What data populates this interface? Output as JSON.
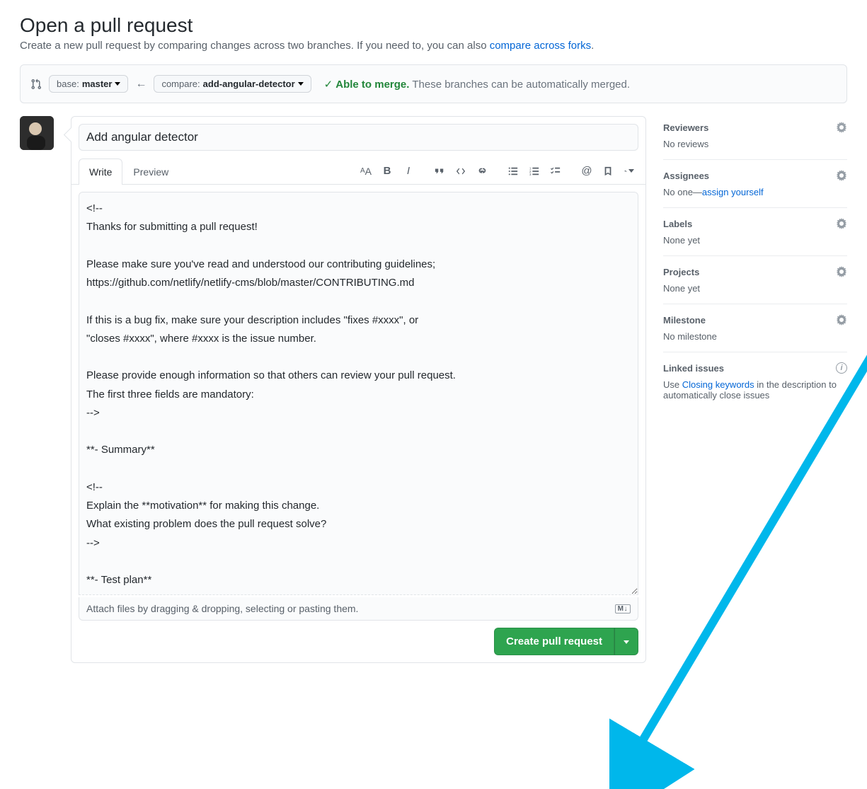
{
  "header": {
    "title": "Open a pull request",
    "subtitle_prefix": "Create a new pull request by comparing changes across two branches. If you need to, you can also ",
    "subtitle_link": "compare across forks",
    "subtitle_suffix": "."
  },
  "compare": {
    "base_label": "base:",
    "base_value": "master",
    "compare_label": "compare:",
    "compare_value": "add-angular-detector",
    "merge_ok_text": "Able to merge.",
    "merge_detail": "These branches can be automatically merged."
  },
  "editor": {
    "title_value": "Add angular detector",
    "tab_write": "Write",
    "tab_preview": "Preview",
    "body_value": "<!--\nThanks for submitting a pull request!\n\nPlease make sure you've read and understood our contributing guidelines;\nhttps://github.com/netlify/netlify-cms/blob/master/CONTRIBUTING.md\n\nIf this is a bug fix, make sure your description includes \"fixes #xxxx\", or\n\"closes #xxxx\", where #xxxx is the issue number.\n\nPlease provide enough information so that others can review your pull request.\nThe first three fields are mandatory:\n-->\n\n**- Summary**\n\n<!--\nExplain the **motivation** for making this change.\nWhat existing problem does the pull request solve?\n-->\n\n**- Test plan**",
    "attach_text": "Attach files by dragging & dropping, selecting or pasting them.",
    "md_badge": "M↓",
    "submit_label": "Create pull request"
  },
  "toolbar_icons": {
    "heading": "heading-icon",
    "bold": "bold-icon",
    "italic": "italic-icon",
    "quote": "quote-icon",
    "code": "code-icon",
    "link": "link-icon",
    "ul": "unordered-list-icon",
    "ol": "ordered-list-icon",
    "task": "task-list-icon",
    "mention": "mention-icon",
    "reference": "reference-icon",
    "reply": "reply-icon"
  },
  "sidebar": {
    "reviewers": {
      "title": "Reviewers",
      "body": "No reviews"
    },
    "assignees": {
      "title": "Assignees",
      "body_prefix": "No one—",
      "body_link": "assign yourself"
    },
    "labels": {
      "title": "Labels",
      "body": "None yet"
    },
    "projects": {
      "title": "Projects",
      "body": "None yet"
    },
    "milestone": {
      "title": "Milestone",
      "body": "No milestone"
    },
    "linked": {
      "title": "Linked issues",
      "body_prefix": "Use ",
      "body_link": "Closing keywords",
      "body_suffix": " in the description to automatically close issues"
    }
  }
}
